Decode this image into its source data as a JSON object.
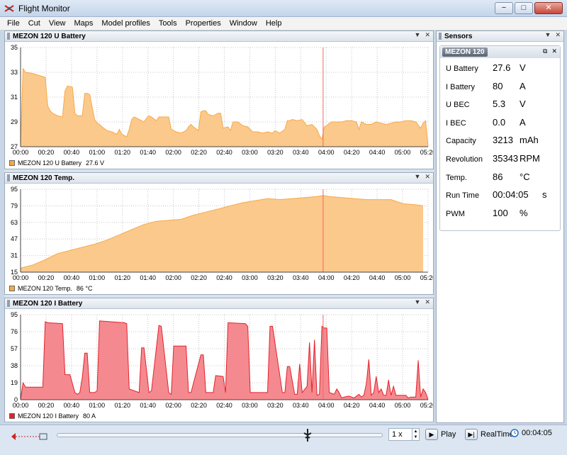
{
  "window": {
    "title": "Flight Monitor",
    "min": "−",
    "max": "□",
    "close": "✕"
  },
  "menu": [
    "File",
    "Cut",
    "View",
    "Maps",
    "Model profiles",
    "Tools",
    "Properties",
    "Window",
    "Help"
  ],
  "panels": [
    {
      "title": "MEZON 120 U Battery",
      "legend_label": "MEZON 120 U Battery",
      "legend_value": "27.6 V",
      "color": "#f6a94a",
      "fill": "#fbc98b",
      "chart_data": {
        "type": "area",
        "xlim": [
          0,
          330
        ],
        "ylim": [
          27,
          35
        ],
        "yticks": [
          "35",
          "33",
          "31",
          "29",
          "27"
        ],
        "xticks": [
          "00:00",
          "00:20",
          "00:40",
          "01:00",
          "01:20",
          "01:40",
          "02:00",
          "02:20",
          "02:40",
          "03:00",
          "03:20",
          "03:40",
          "04:00",
          "04:20",
          "04:40",
          "05:00",
          "05:20"
        ],
        "cursor_x": 245,
        "x": [
          0,
          2,
          4,
          10,
          20,
          22,
          24,
          26,
          30,
          34,
          36,
          38,
          42,
          44,
          46,
          50,
          52,
          54,
          56,
          60,
          62,
          64,
          66,
          70,
          74,
          78,
          80,
          82,
          86,
          88,
          90,
          92,
          96,
          100,
          102,
          104,
          106,
          110,
          112,
          116,
          120,
          122,
          124,
          126,
          130,
          134,
          136,
          138,
          140,
          144,
          146,
          148,
          150,
          152,
          156,
          160,
          162,
          164,
          168,
          170,
          172,
          176,
          180,
          184,
          186,
          188,
          192,
          196,
          200,
          204,
          206,
          210,
          214,
          216,
          218,
          220,
          224,
          228,
          232,
          236,
          240,
          242,
          244,
          246,
          248,
          250,
          252,
          256,
          260,
          264,
          268,
          272,
          274,
          276,
          280,
          284,
          288,
          292,
          296,
          300,
          304,
          308,
          312,
          316,
          320,
          324,
          326,
          328,
          330
        ],
        "y": [
          27,
          33.3,
          33,
          32.9,
          32.6,
          30.3,
          29.9,
          29.7,
          29.5,
          29.4,
          31.5,
          31.9,
          31.8,
          29.7,
          29.5,
          29.5,
          31.3,
          31.3,
          31.2,
          29.2,
          28.9,
          28.8,
          28.6,
          28.3,
          28.2,
          28,
          28.4,
          28,
          27.8,
          28.4,
          29.2,
          29.4,
          29.2,
          29,
          29.3,
          29.5,
          29.4,
          29.1,
          29.4,
          29.4,
          29.4,
          28.4,
          28.3,
          28.2,
          28.1,
          28.3,
          28.6,
          28.8,
          28.6,
          28.3,
          29.8,
          29.9,
          29.9,
          29.6,
          29.5,
          29.7,
          29.7,
          28.5,
          28.6,
          28.3,
          29,
          29,
          28.7,
          28.6,
          28.4,
          28.2,
          28.2,
          28.1,
          28.2,
          28.1,
          28.3,
          28.1,
          28.4,
          29.1,
          29.1,
          29.2,
          29.1,
          29.2,
          28.7,
          28.8,
          28.4,
          27.9,
          27.6,
          28.6,
          28.7,
          28.9,
          29,
          29,
          29,
          29.1,
          29.1,
          29,
          28.4,
          29,
          28.8,
          28.8,
          29,
          28.9,
          28.8,
          28.9,
          29,
          29,
          29.1,
          29.1,
          29,
          28.5,
          28.9,
          29.1,
          27
        ]
      }
    },
    {
      "title": "MEZON 120 Temp.",
      "legend_label": "MEZON 120 Temp.",
      "legend_value": "86 °C",
      "color": "#f6a94a",
      "fill": "#fbc98b",
      "chart_data": {
        "type": "area",
        "xlim": [
          0,
          330
        ],
        "ylim": [
          15,
          95
        ],
        "yticks": [
          "95",
          "79",
          "63",
          "47",
          "31",
          "15"
        ],
        "xticks": [
          "00:00",
          "00:20",
          "00:40",
          "01:00",
          "01:20",
          "01:40",
          "02:00",
          "02:20",
          "02:40",
          "03:00",
          "03:20",
          "03:40",
          "04:00",
          "04:20",
          "04:40",
          "05:00",
          "05:20"
        ],
        "cursor_x": 245,
        "x": [
          0,
          10,
          20,
          30,
          40,
          50,
          60,
          70,
          80,
          90,
          100,
          110,
          120,
          130,
          140,
          150,
          160,
          170,
          180,
          190,
          200,
          210,
          220,
          230,
          240,
          245,
          250,
          260,
          270,
          280,
          290,
          300,
          310,
          320,
          326
        ],
        "y": [
          19,
          22,
          27,
          33,
          36,
          39,
          42,
          46,
          51,
          56,
          61,
          64,
          65,
          66,
          70,
          73,
          76,
          79,
          82,
          84,
          86,
          85,
          86,
          87,
          88,
          89,
          88,
          87,
          86,
          85,
          85,
          85,
          81,
          80,
          79
        ]
      }
    },
    {
      "title": "MEZON 120 I Battery",
      "legend_label": "MEZON 120 I Battery",
      "legend_value": "80 A",
      "color": "#e4222c",
      "fill": "#f48a8f",
      "chart_data": {
        "type": "area",
        "xlim": [
          0,
          330
        ],
        "ylim": [
          0,
          95
        ],
        "yticks": [
          "95",
          "76",
          "57",
          "38",
          "19",
          "0"
        ],
        "xticks": [
          "00:00",
          "00:20",
          "00:40",
          "01:00",
          "01:20",
          "01:40",
          "02:00",
          "02:20",
          "02:40",
          "03:00",
          "03:20",
          "03:40",
          "04:00",
          "04:20",
          "04:40",
          "05:00",
          "05:20"
        ],
        "cursor_x": 245,
        "x": [
          0,
          2,
          4,
          18,
          20,
          22,
          34,
          36,
          40,
          44,
          46,
          48,
          50,
          52,
          54,
          56,
          60,
          62,
          64,
          84,
          86,
          88,
          96,
          98,
          100,
          104,
          106,
          112,
          114,
          120,
          122,
          124,
          134,
          136,
          138,
          146,
          148,
          150,
          154,
          156,
          158,
          164,
          166,
          168,
          182,
          184,
          186,
          200,
          202,
          204,
          212,
          214,
          216,
          218,
          222,
          224,
          226,
          228,
          232,
          234,
          236,
          238,
          240,
          242,
          244,
          246,
          248,
          250,
          254,
          256,
          258,
          260,
          262,
          266,
          268,
          270,
          272,
          274,
          276,
          278,
          280,
          282,
          284,
          286,
          288,
          290,
          292,
          294,
          296,
          298,
          300,
          302,
          304,
          312,
          314,
          316,
          320,
          322,
          324,
          326,
          328,
          330
        ],
        "y": [
          0,
          19,
          14,
          14,
          87,
          86,
          85,
          28,
          28,
          8,
          6,
          8,
          25,
          52,
          52,
          8,
          8,
          10,
          88,
          86,
          85,
          12,
          8,
          58,
          58,
          8,
          10,
          83,
          82,
          8,
          6,
          60,
          60,
          8,
          8,
          50,
          50,
          8,
          8,
          8,
          27,
          26,
          8,
          86,
          85,
          82,
          8,
          8,
          82,
          82,
          8,
          8,
          37,
          37,
          6,
          6,
          40,
          8,
          15,
          64,
          8,
          67,
          5,
          6,
          82,
          80,
          80,
          8,
          6,
          12,
          8,
          2,
          3,
          4,
          3,
          2,
          4,
          6,
          3,
          5,
          18,
          45,
          5,
          8,
          26,
          8,
          12,
          5,
          5,
          22,
          5,
          15,
          5,
          5,
          2,
          3,
          3,
          44,
          3,
          12,
          8,
          0
        ]
      }
    }
  ],
  "sensors": {
    "title": "Sensors",
    "device": "MEZON 120",
    "rows": [
      {
        "label": "U Battery",
        "value": "27.6",
        "unit": "V"
      },
      {
        "label": "I Battery",
        "value": "80",
        "unit": "A"
      },
      {
        "label": "U BEC",
        "value": "5.3",
        "unit": "V"
      },
      {
        "label": "I BEC",
        "value": "0.0",
        "unit": "A"
      },
      {
        "label": "Capacity",
        "value": "3213",
        "unit": "mAh"
      },
      {
        "label": "Revolution",
        "value": "35343",
        "unit": "RPM"
      },
      {
        "label": "Temp.",
        "value": "86",
        "unit": "°C"
      },
      {
        "label": "Run Time",
        "value": "00:04:05",
        "unit": "s"
      },
      {
        "label": "PWM",
        "value": "100",
        "unit": "%"
      }
    ]
  },
  "bottom": {
    "speed": "1 x",
    "play_label": "Play",
    "realtime_label": "RealTime",
    "time": "00:04:05",
    "slider_fraction": 0.77
  }
}
